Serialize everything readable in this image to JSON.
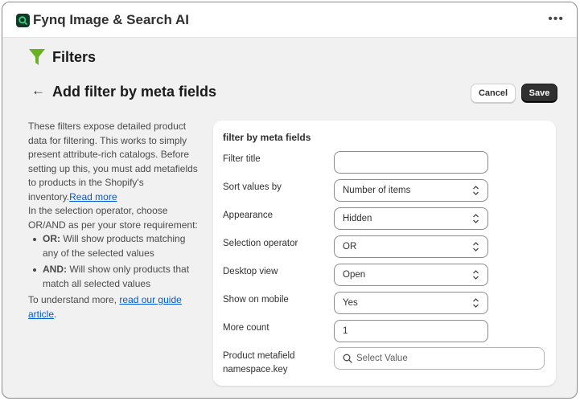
{
  "app": {
    "title": "Fynq Image & Search AI",
    "more_glyph": "•••"
  },
  "section": {
    "title": "Filters",
    "icon": "funnel-icon",
    "icon_color": "#6ab023"
  },
  "page": {
    "back_glyph": "←",
    "title": "Add filter by meta fields",
    "cancel_label": "Cancel",
    "save_label": "Save"
  },
  "description": {
    "paragraph1": "These filters expose detailed product data for filtering. This works to simply present attribute-rich catalogs. Before setting up this, you must add metafields to products in the Shopify's inventory.",
    "read_more": "Read more",
    "paragraph2": "In the selection operator, choose OR/AND as per your store requirement:",
    "bullets": [
      {
        "key": "OR:",
        "text": " Will show products matching any of the selected values"
      },
      {
        "key": "AND:",
        "text": " Will show only products that match all selected values"
      }
    ],
    "guide_prefix": "To understand more, ",
    "guide_link": "read our guide article",
    "guide_suffix": "."
  },
  "form": {
    "title": "filter by meta fields",
    "fields": [
      {
        "label": "Filter title",
        "value": "",
        "type": "text"
      },
      {
        "label": "Sort values by",
        "value": "Number of items",
        "type": "select"
      },
      {
        "label": "Appearance",
        "value": "Hidden",
        "type": "select"
      },
      {
        "label": "Selection operator",
        "value": "OR",
        "type": "select"
      },
      {
        "label": "Desktop view",
        "value": "Open",
        "type": "select"
      },
      {
        "label": "Show on mobile",
        "value": "Yes",
        "type": "select"
      },
      {
        "label": "More count",
        "value": "1",
        "type": "text"
      },
      {
        "label": "Product metafield namespace.key",
        "value": "",
        "placeholder": "Select Value",
        "type": "search"
      }
    ]
  },
  "colors": {
    "link": "#005bd3",
    "save_bg": "#303030",
    "logo_bg": "#0f3a2a"
  }
}
